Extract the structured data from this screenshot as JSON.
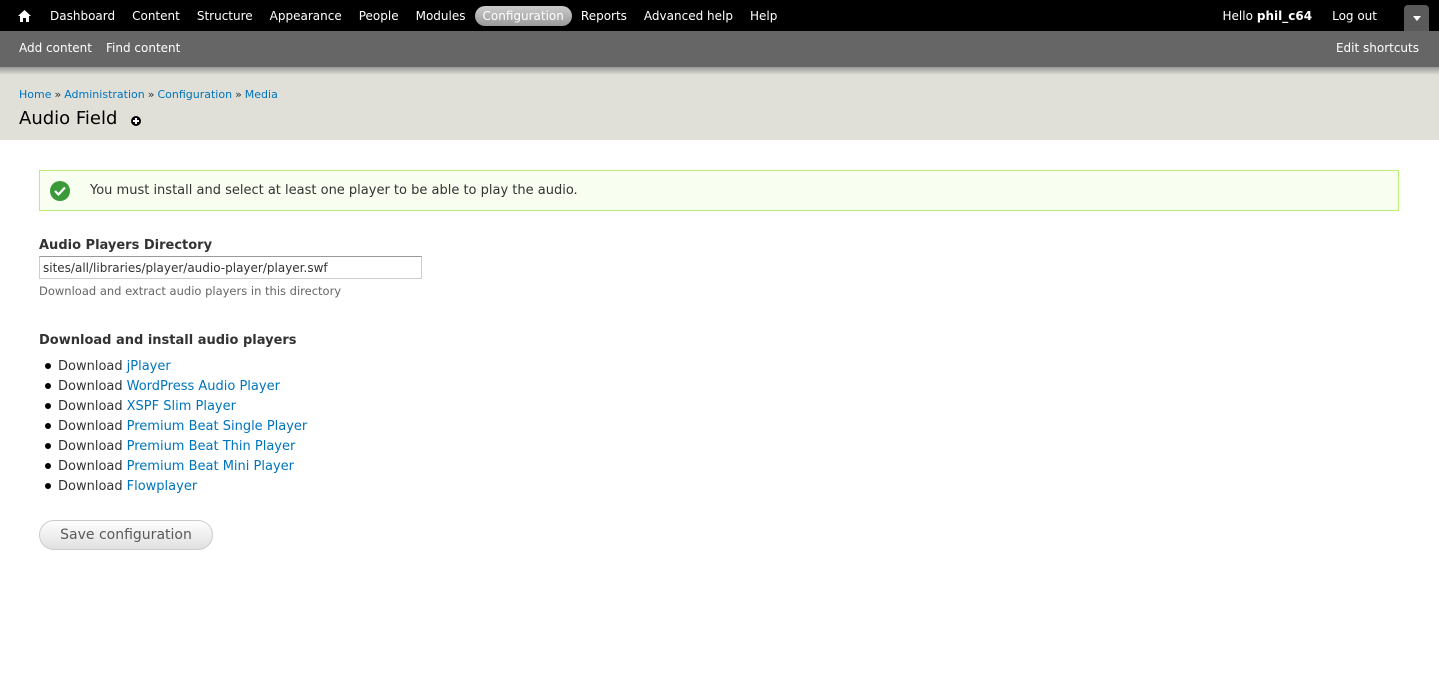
{
  "toolbar": {
    "home_icon": "home-icon",
    "menu": [
      {
        "label": "Dashboard",
        "active": false
      },
      {
        "label": "Content",
        "active": false
      },
      {
        "label": "Structure",
        "active": false
      },
      {
        "label": "Appearance",
        "active": false
      },
      {
        "label": "People",
        "active": false
      },
      {
        "label": "Modules",
        "active": false
      },
      {
        "label": "Configuration",
        "active": true
      },
      {
        "label": "Reports",
        "active": false
      },
      {
        "label": "Advanced help",
        "active": false
      },
      {
        "label": "Help",
        "active": false
      }
    ],
    "greeting": "Hello",
    "username": "phil_c64",
    "logout": "Log out",
    "toggle_icon": "chevron-down-icon"
  },
  "shortcuts": {
    "links": [
      "Add content",
      "Find content"
    ],
    "edit": "Edit shortcuts"
  },
  "breadcrumb": {
    "items": [
      "Home",
      "Administration",
      "Configuration",
      "Media"
    ],
    "separator": "»"
  },
  "page": {
    "title": "Audio Field"
  },
  "message": {
    "status": "ok",
    "text": "You must install and select at least one player to be able to play the audio."
  },
  "form": {
    "directory_label": "Audio Players Directory",
    "directory_value": "sites/all/libraries/player/audio-player/player.swf",
    "directory_description": "Download and extract audio players in this directory",
    "section_title": "Download and install audio players",
    "download_prefix": "Download",
    "players": [
      "jPlayer",
      "WordPress Audio Player",
      "XSPF Slim Player",
      "Premium Beat Single Player",
      "Premium Beat Thin Player",
      "Premium Beat Mini Player",
      "Flowplayer"
    ],
    "save_label": "Save configuration"
  },
  "colors": {
    "link": "#0074bd",
    "toolbar_bg": "#000000",
    "shortcuts_bg": "#666666",
    "branding_bg": "#e0e0d8",
    "message_bg": "#f8fff0",
    "message_border": "#bbee77"
  }
}
